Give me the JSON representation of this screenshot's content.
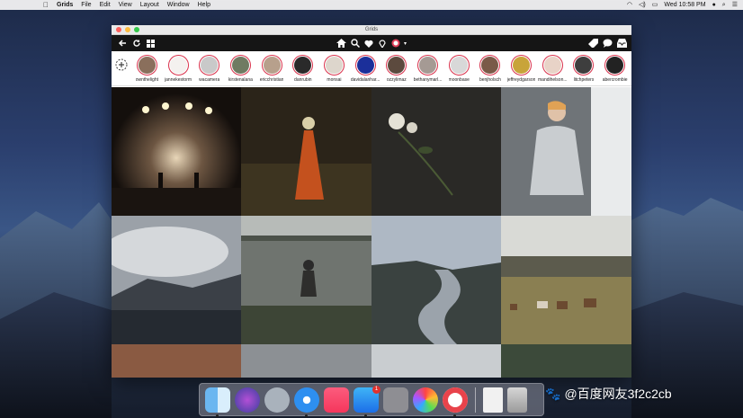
{
  "menubar": {
    "app_name": "Grids",
    "menus": [
      "File",
      "Edit",
      "View",
      "Layout",
      "Window",
      "Help"
    ],
    "clock": "Wed 10:58 PM"
  },
  "window": {
    "title": "Grids"
  },
  "stories": [
    {
      "name": "ownthelight",
      "color": "#8a6f5c"
    },
    {
      "name": "jannekestorm",
      "color": "#f4f1ef"
    },
    {
      "name": "wacamera",
      "color": "#c9c9c9"
    },
    {
      "name": "kirstenalana",
      "color": "#6f7b62"
    },
    {
      "name": "ericchristian",
      "color": "#b7a08c"
    },
    {
      "name": "danrubin",
      "color": "#2a2a2a"
    },
    {
      "name": "monsai",
      "color": "#ddd6cc"
    },
    {
      "name": "davidalanhar...",
      "color": "#1b2f9a"
    },
    {
      "name": "ozzylimaz",
      "color": "#5c4a3e"
    },
    {
      "name": "bethanymarl...",
      "color": "#a59a94"
    },
    {
      "name": "moonbase",
      "color": "#d8d8d8"
    },
    {
      "name": "benjholsch",
      "color": "#7a5a48"
    },
    {
      "name": "jeffreydgarson",
      "color": "#c8a43a"
    },
    {
      "name": "mandihelson...",
      "color": "#e8d3c7"
    },
    {
      "name": "litchpeters",
      "color": "#3e3e3e"
    },
    {
      "name": "abercrombie",
      "color": "#222222"
    }
  ],
  "dock": {
    "badge_count": "1"
  },
  "watermark": "@百度网友3f2c2cb"
}
